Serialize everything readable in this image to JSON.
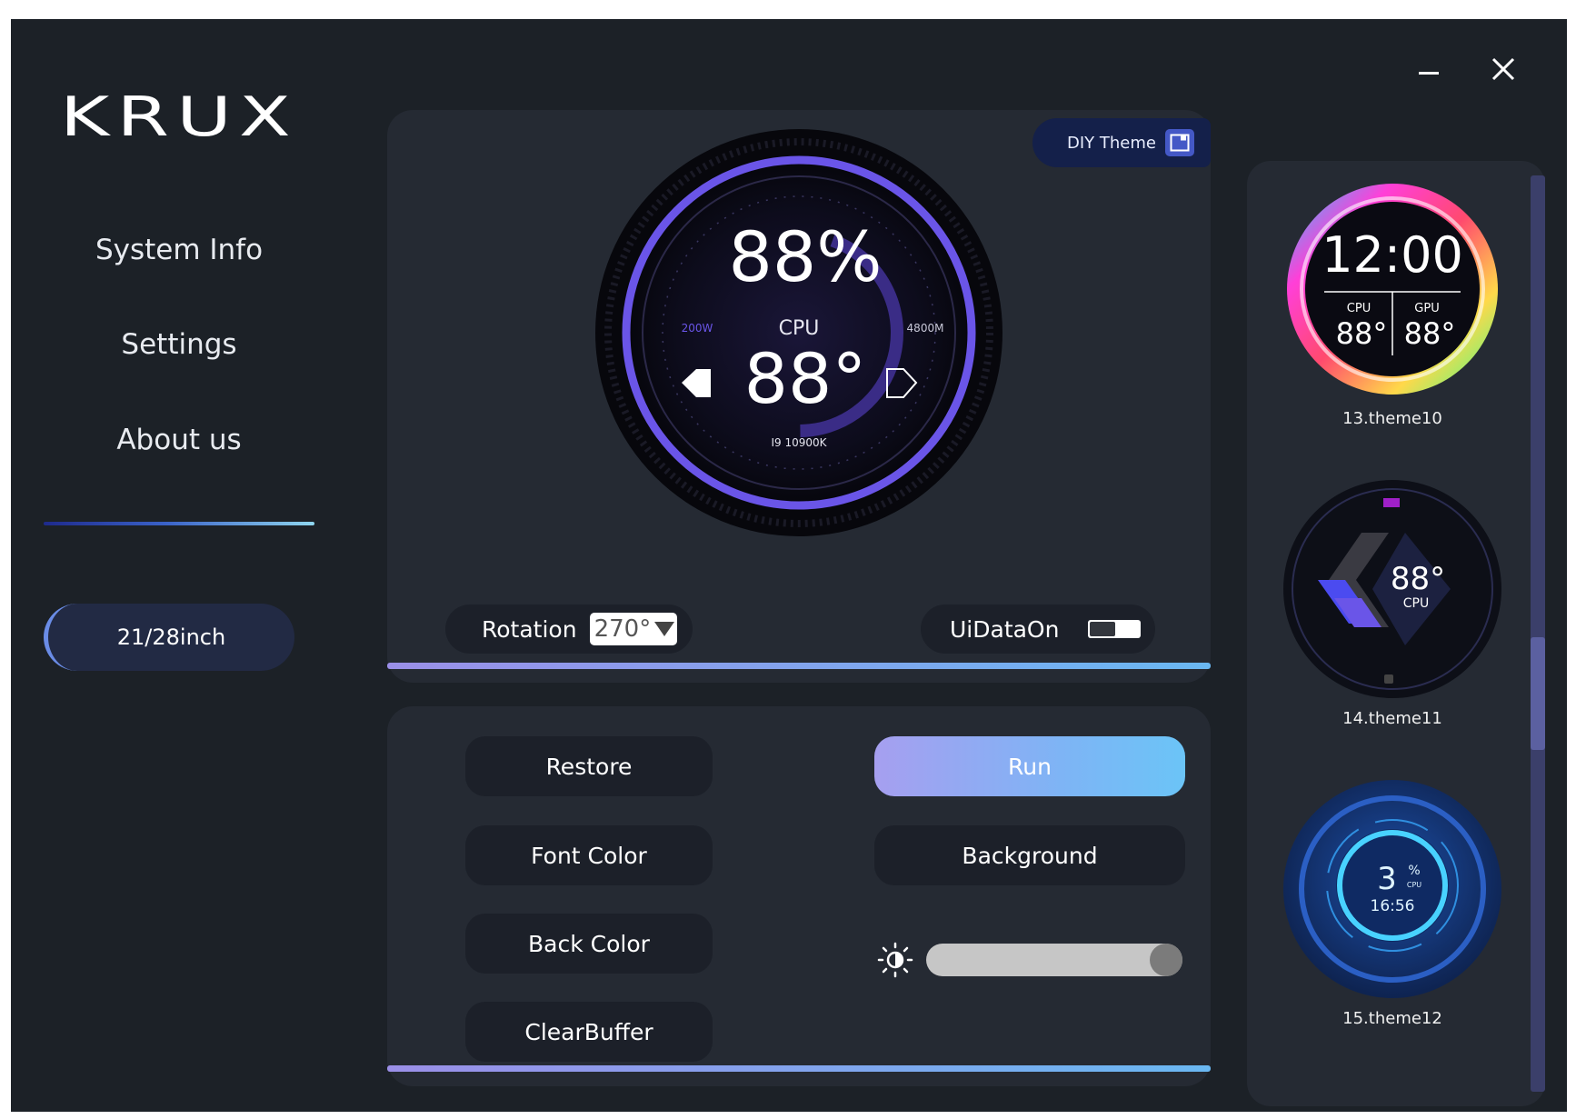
{
  "app": {
    "logo_text": "KRUX"
  },
  "nav": {
    "items": [
      {
        "label": "System Info"
      },
      {
        "label": "Settings"
      },
      {
        "label": "About us"
      }
    ],
    "size_button": "21/28inch"
  },
  "preview": {
    "diy_theme_label": "DIY Theme",
    "gauge": {
      "percent": "88%",
      "label": "CPU",
      "temperature": "88°",
      "left_value": "200W",
      "right_value": "4800M",
      "model": "I9 10900K"
    },
    "rotation_label": "Rotation",
    "rotation_value": "270°",
    "uidata_label": "UiDataOn",
    "uidata_on": false
  },
  "actions": {
    "restore": "Restore",
    "run": "Run",
    "font_color": "Font Color",
    "background": "Background",
    "back_color": "Back Color",
    "clear_buffer": "ClearBuffer",
    "brightness_level": 1.0
  },
  "themes": [
    {
      "label": "13.theme10",
      "time": "12:00",
      "cpu_label": "CPU",
      "gpu_label": "GPU",
      "cpu_value": "88°",
      "gpu_value": "88°"
    },
    {
      "label": "14.theme11",
      "value": "88°",
      "sub_label": "CPU"
    },
    {
      "label": "15.theme12",
      "value": "3",
      "unit": "%",
      "sub_label": "CPU",
      "time": "16:56"
    }
  ],
  "colors": {
    "background": "#1c2127",
    "panel": "#252a33",
    "accent_purple": "#6a55e8",
    "accent_blue": "#6bc4f7"
  },
  "icons": [
    "minimize-icon",
    "close-icon",
    "diy-theme-icon",
    "brightness-icon",
    "dropdown-arrow-icon"
  ]
}
